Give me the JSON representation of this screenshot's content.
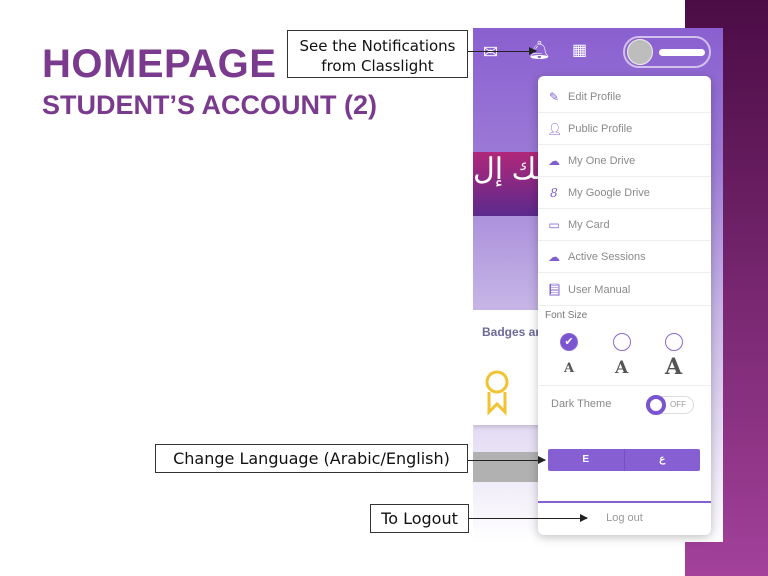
{
  "slide": {
    "title": "HOMEPAGE",
    "subtitle": "STUDENT’S ACCOUNT (2)"
  },
  "callouts": {
    "notifications": "See the Notifications from Classlight",
    "language": "Change Language (Arabic/English)",
    "logout": "To Logout"
  },
  "app": {
    "banner_text": "طك إل",
    "card_title": "Badges an",
    "header_icons": [
      "mail-icon",
      "bell-icon",
      "building-icon"
    ],
    "menu": [
      {
        "label": "Edit Profile",
        "icon": "pencil-icon"
      },
      {
        "label": "Public Profile",
        "icon": "user-icon"
      },
      {
        "label": "My One Drive",
        "icon": "cloud-icon"
      },
      {
        "label": "My Google Drive",
        "icon": "google-icon"
      },
      {
        "label": "My Card",
        "icon": "card-icon"
      },
      {
        "label": "Active Sessions",
        "icon": "cloud-icon"
      },
      {
        "label": "User Manual",
        "icon": "book-icon"
      }
    ],
    "font_size": {
      "label": "Font Size",
      "options": [
        "A",
        "A",
        "A"
      ],
      "selected": 0
    },
    "dark_theme": {
      "label": "Dark Theme",
      "state": "OFF"
    },
    "language": {
      "options": [
        "E",
        "ع"
      ]
    },
    "logout": "Log out",
    "colors": {
      "accent": "#7a55cf",
      "title": "#7a3b8e",
      "badge": "#f2c230"
    }
  }
}
